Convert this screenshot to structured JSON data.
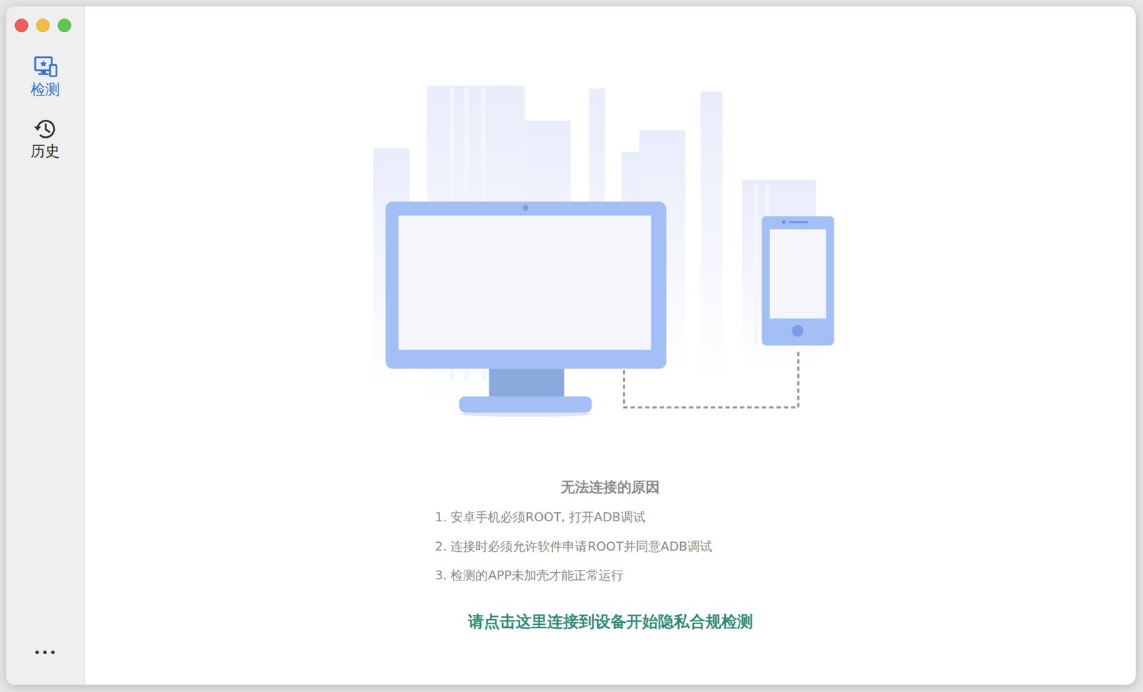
{
  "sidebar": {
    "items": [
      {
        "label": "检测",
        "selected": true
      },
      {
        "label": "历史",
        "selected": false
      }
    ],
    "more": "•••"
  },
  "main": {
    "heading": "无法连接的原因",
    "reasons": [
      "1. 安卓手机必须ROOT, 打开ADB调试",
      "2. 连接时必须允许软件申请ROOT并同意ADB调试",
      "3. 检测的APP未加壳才能正常运行"
    ],
    "connect_link": "请点击这里连接到设备开始隐私合规检测"
  }
}
